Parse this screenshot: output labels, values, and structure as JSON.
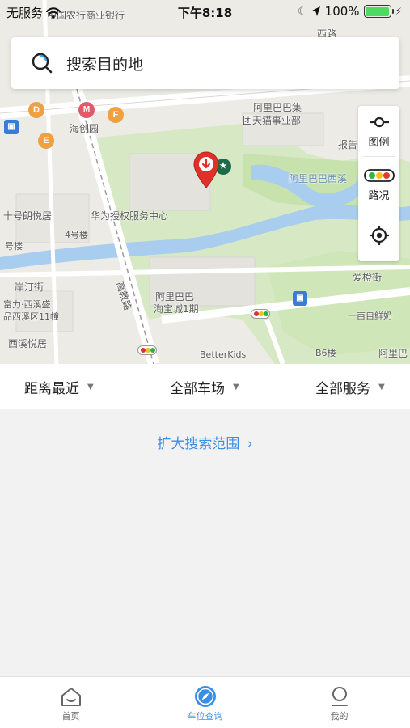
{
  "status_bar": {
    "carrier": "无服务",
    "time": "下午8:18",
    "battery_percent": "100%",
    "battery_level": 1.0
  },
  "search": {
    "placeholder": "搜索目的地"
  },
  "map_controls": {
    "legend_label": "图例",
    "traffic_label": "路况"
  },
  "map_labels": {
    "bank": "中国农行商业银行",
    "haichuangyuan": "海创园",
    "alibaba_group": "阿里巴巴集",
    "tmall_dept": "团天猫事业部",
    "baogao": "报告",
    "alibaba_west": "阿里巴巴西溪",
    "shiyihao": "十号朗悦居",
    "huawei": "华为授权服务中心",
    "building4": "4号楼",
    "dorm": "号楼",
    "antingjie": "岸汀街",
    "fuli": "富力·西溪盛",
    "xixi_mall": "品西溪区11幢",
    "xixi_yueju": "西溪悦居",
    "gaojiaolu": "高教路",
    "taobao_city_1": "阿里巴巴",
    "taobao_city_2": "淘宝城1期",
    "aichengjie": "爱橙街",
    "yimu": "一亩自鲜奶",
    "betterkids": "BetterKids",
    "b6": "B6楼",
    "alibaba_right": "阿里巴",
    "road_top_right": "西路",
    "badge_d": "D",
    "badge_f": "F",
    "badge_e": "E"
  },
  "filters": {
    "distance": "距离最近",
    "parking": "全部车场",
    "service": "全部服务"
  },
  "content": {
    "expand_label": "扩大搜索范围",
    "expand_chevron": "›"
  },
  "tabs": [
    {
      "label": "首页",
      "icon": "home-icon",
      "active": false
    },
    {
      "label": "车位查询",
      "icon": "compass-icon",
      "active": true
    },
    {
      "label": "我的",
      "icon": "person-icon",
      "active": false
    }
  ],
  "colors": {
    "accent": "#3a8ee6",
    "pin": "#e0302a",
    "water": "#a9cdee",
    "green": "#cfe6b8"
  }
}
